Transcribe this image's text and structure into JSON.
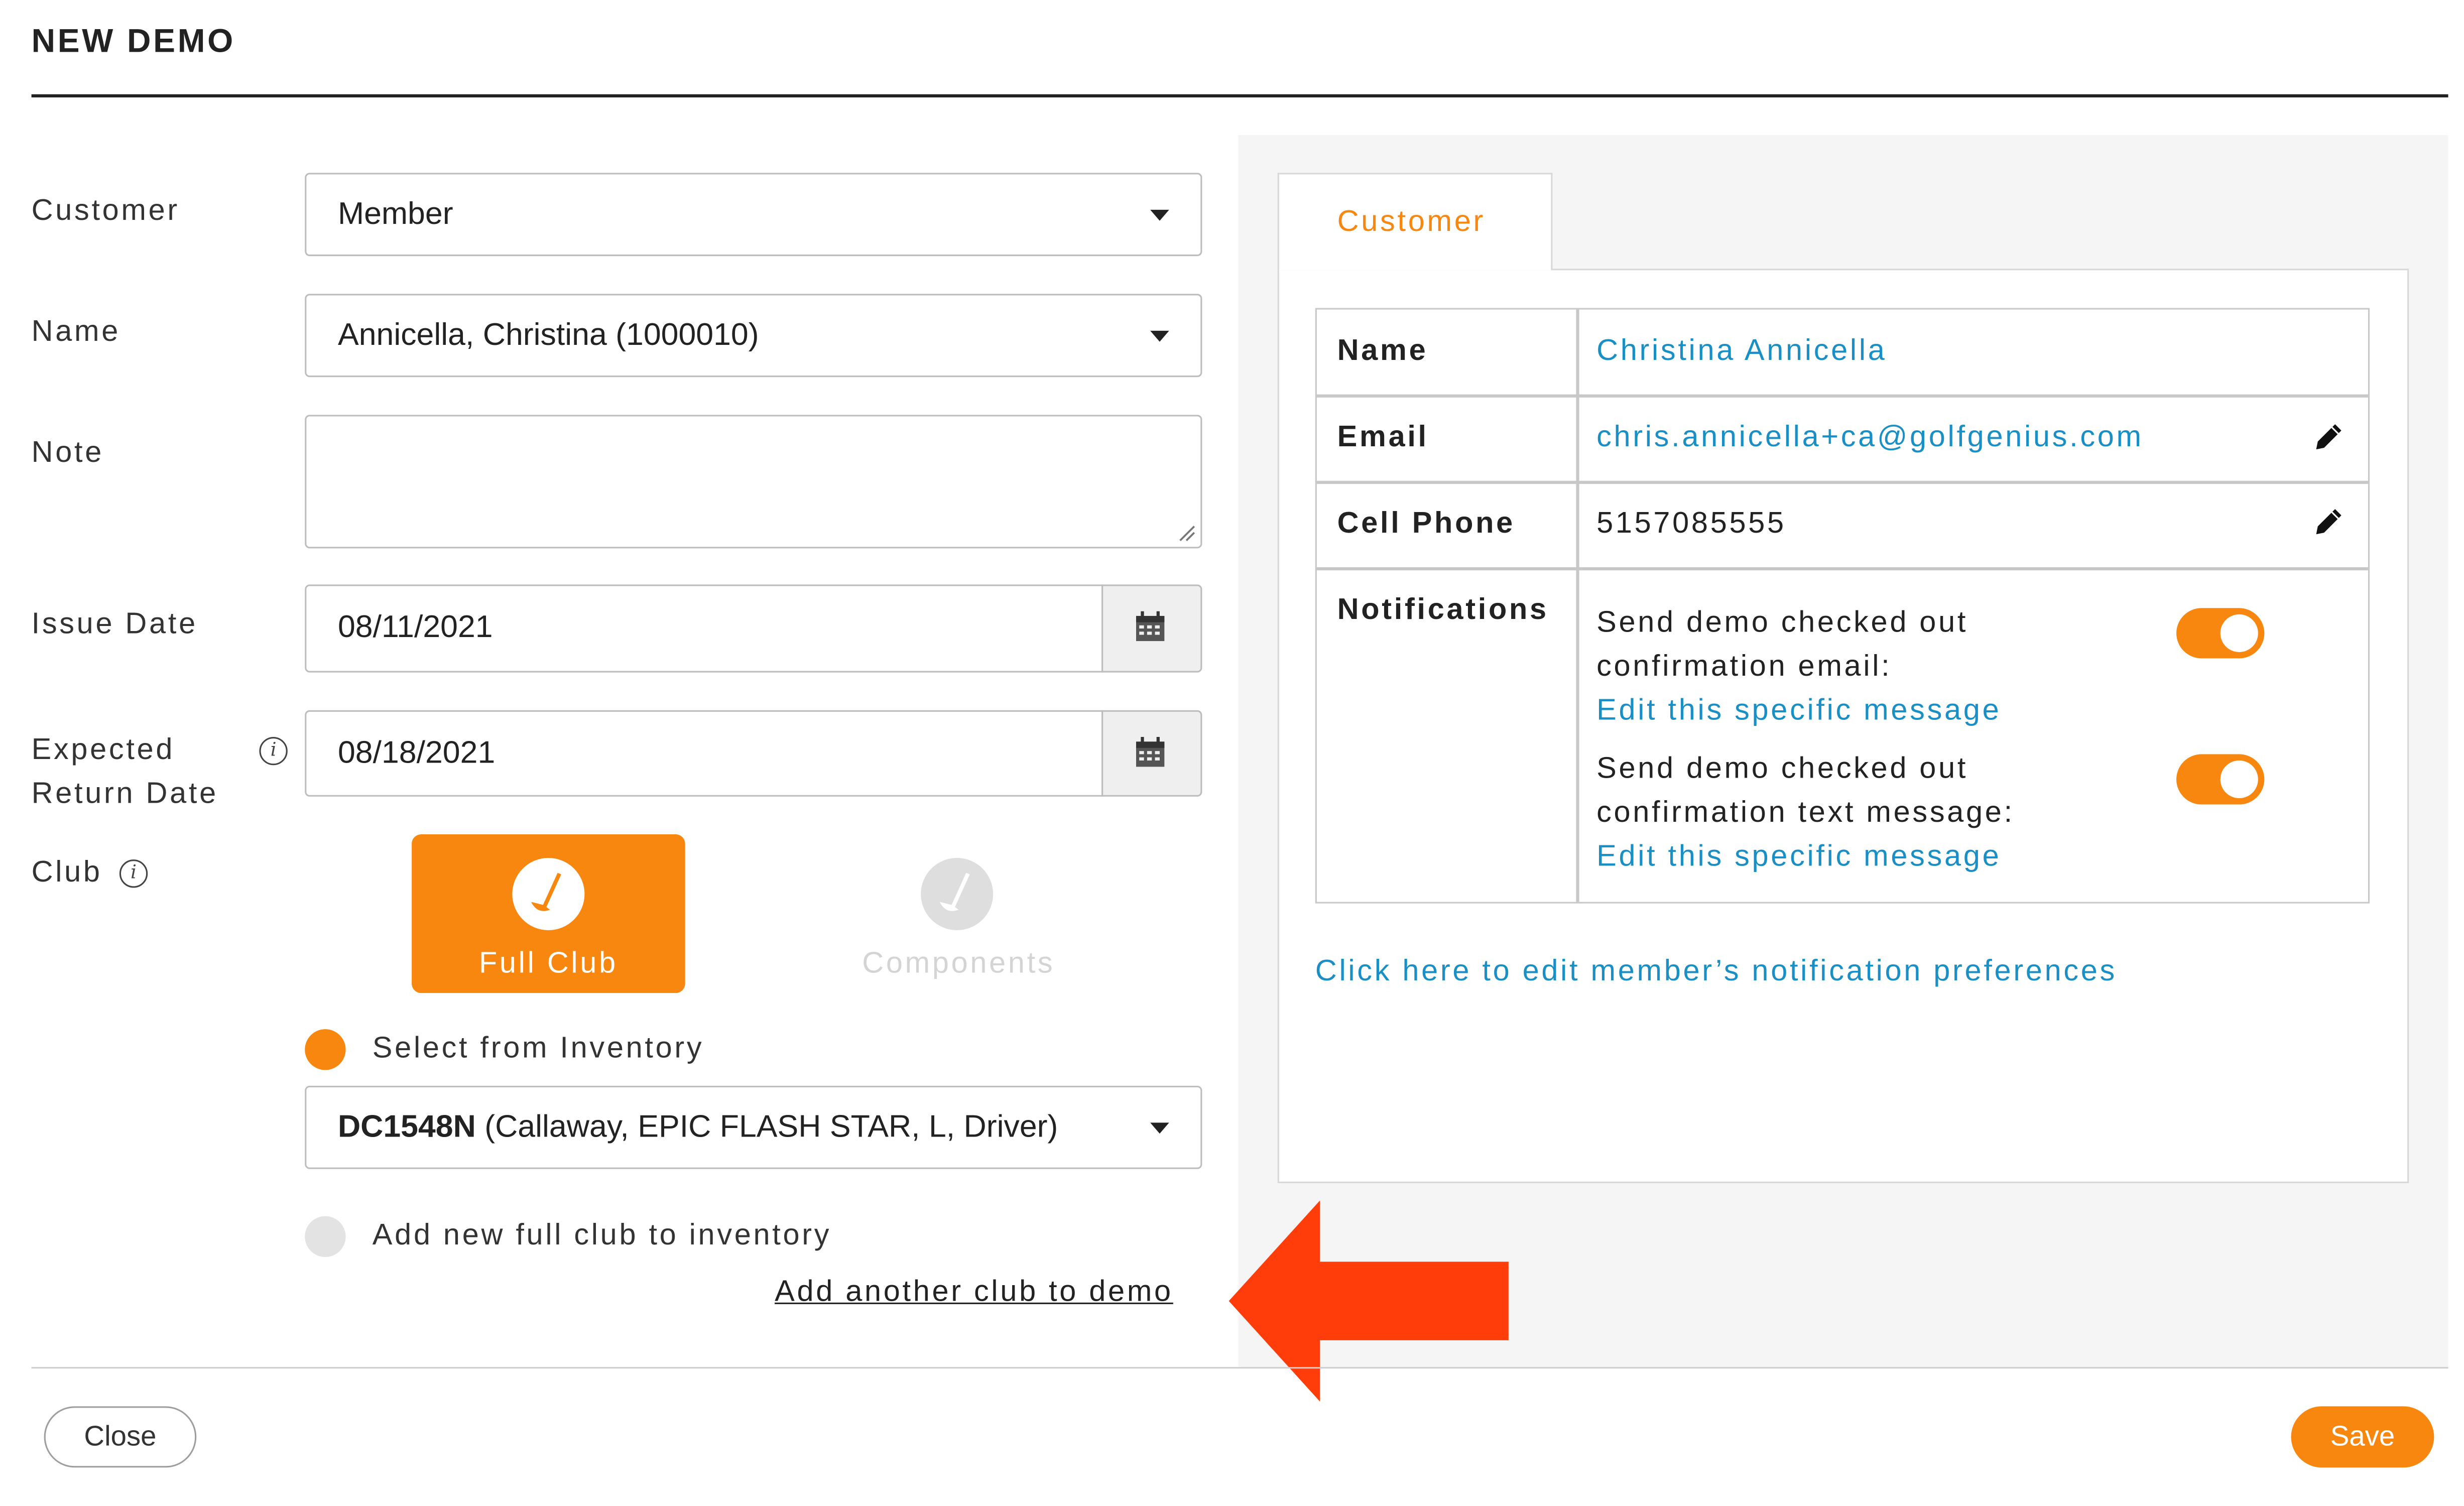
{
  "dialog": {
    "title": "NEW DEMO"
  },
  "form": {
    "customer": {
      "label": "Customer",
      "value": "Member"
    },
    "name": {
      "label": "Name",
      "value": "Annicella, Christina (1000010)"
    },
    "note": {
      "label": "Note",
      "value": ""
    },
    "issue_date": {
      "label": "Issue Date",
      "value": "08/11/2021"
    },
    "expected_return": {
      "label_line1": "Expected",
      "label_line2": "Return Date",
      "value": "08/18/2021"
    },
    "club": {
      "label": "Club",
      "options": [
        {
          "label": "Full Club",
          "selected": true
        },
        {
          "label": "Components",
          "selected": false
        }
      ]
    },
    "select_from_inventory": {
      "label": "Select from Inventory",
      "selected": true
    },
    "inventory_select": {
      "code": "DC1548N",
      "detail": " (Callaway, EPIC FLASH STAR, L, Driver)"
    },
    "add_new_full_club": {
      "label": "Add new full club to inventory",
      "selected": false
    },
    "add_another_link": "Add another club to demo"
  },
  "customer_panel": {
    "tab_label": "Customer",
    "rows": [
      {
        "label": "Name",
        "value": "Christina Annicella"
      },
      {
        "label": "Email",
        "value": "chris.annicella+ca@golfgenius.com"
      },
      {
        "label": "Cell Phone",
        "value": "5157085555"
      }
    ],
    "notifications": {
      "label": "Notifications",
      "items": [
        {
          "line1": "Send demo checked out",
          "line2": "confirmation email:",
          "link": "Edit this specific message",
          "enabled": true
        },
        {
          "line1": "Send demo checked out",
          "line2": "confirmation text message:",
          "link": "Edit this specific message",
          "enabled": true
        }
      ]
    },
    "preferences_link": "Click here to edit member’s notification preferences"
  },
  "footer": {
    "close_label": "Close",
    "save_label": "Save"
  },
  "colors": {
    "accent": "#f7870f",
    "link": "#1a8fc5",
    "arrow": "#ff3d0a"
  }
}
